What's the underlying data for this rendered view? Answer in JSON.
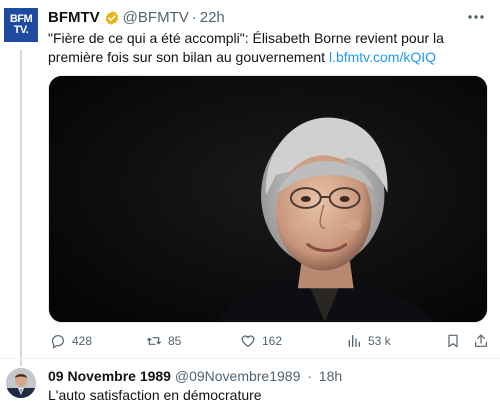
{
  "tweet": {
    "author_name": "BFMTV",
    "handle": "@BFMTV",
    "separator": "·",
    "time": "22h",
    "avatar_lines": [
      "BFM",
      "TV."
    ],
    "text_main": "\"Fière de ce qui a été accompli\": Élisabeth Borne revient pour la première fois sur son bilan au gouvernement ",
    "text_link": "l.bfmtv.com/kQIQ",
    "actions": {
      "replies": "428",
      "retweets": "85",
      "likes": "162",
      "views": "53 k"
    }
  },
  "reply": {
    "author_name": "09 Novembre 1989",
    "handle": "@09Novembre1989",
    "separator": "·",
    "time": "18h",
    "text": "L'auto satisfaction en démocrature"
  },
  "icons": [
    "verified-badge-icon",
    "more-icon",
    "reply-icon",
    "retweet-icon",
    "like-icon",
    "views-icon",
    "bookmark-icon",
    "share-icon"
  ],
  "colors": {
    "link": "#1d9bf0",
    "secondary_text": "#536471",
    "verified_gold": "#e2b719",
    "bfm_blue": "#1e4b9f"
  }
}
